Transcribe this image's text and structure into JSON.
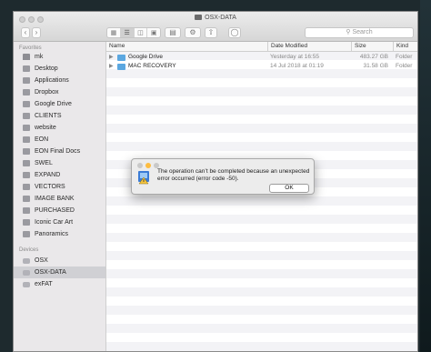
{
  "window": {
    "title": "OSX-DATA"
  },
  "toolbar": {
    "search_placeholder": "Search"
  },
  "sidebar": {
    "favorites_label": "Favorites",
    "favorites": [
      "mk",
      "Desktop",
      "Applications",
      "Dropbox",
      "Google Drive",
      "CLIENTS",
      "website",
      "EON",
      "EON Final Docs",
      "SWEL",
      "EXPAND",
      "VECTORS",
      "IMAGE BANK",
      "PURCHASED",
      "Iconic Car Art",
      "Panoramics"
    ],
    "devices_label": "Devices",
    "devices": [
      "OSX",
      "OSX-DATA",
      "exFAT"
    ],
    "selected": "OSX-DATA"
  },
  "columns": {
    "name": "Name",
    "date": "Date Modified",
    "size": "Size",
    "kind": "Kind"
  },
  "files": [
    {
      "name": "Google Drive",
      "date": "Yesterday at 16:55",
      "size": "483.27 GB",
      "kind": "Folder"
    },
    {
      "name": "MAC RECOVERY",
      "date": "14 Jul 2018 at 01:19",
      "size": "31.58 GB",
      "kind": "Folder"
    }
  ],
  "dialog": {
    "message": "The operation can’t be completed because an unexpected error occurred (error code -50).",
    "ok_label": "OK"
  },
  "colors": {
    "folder": "#5ba7e0",
    "close": "#fc605c",
    "minimize": "#fdbc40",
    "zoom": "#34c84a"
  }
}
